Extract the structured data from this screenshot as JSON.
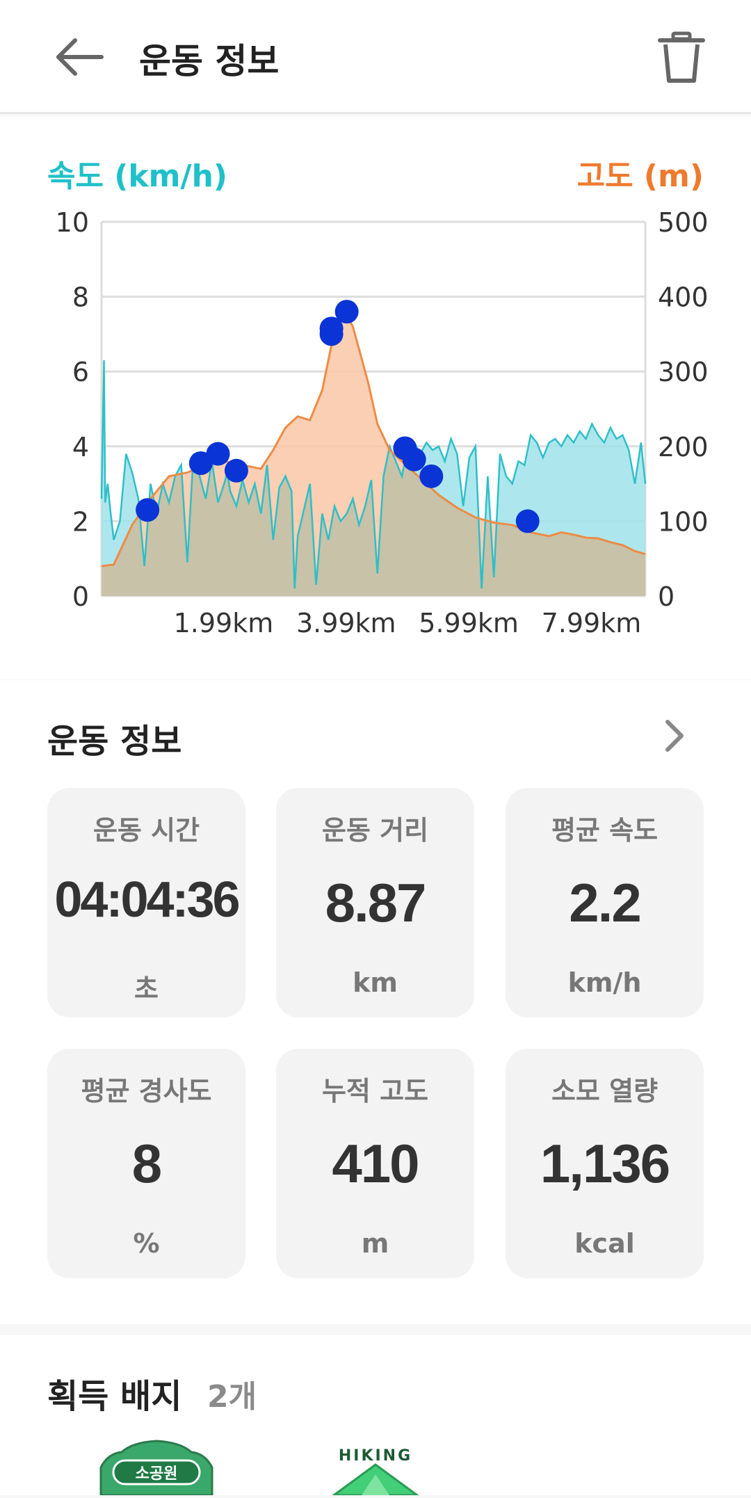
{
  "header": {
    "title": "운동 정보",
    "back_icon": "arrow-left-icon",
    "delete_icon": "trash-icon"
  },
  "chart_data": {
    "type": "area",
    "left_axis_label": "속도 (km/h)",
    "right_axis_label": "고도 (m)",
    "left_axis_color": "#1fc0c9",
    "right_axis_color": "#ee7a2e",
    "ylim_left": [
      0,
      10
    ],
    "ylim_right": [
      0,
      500
    ],
    "xlim": [
      0,
      8.87
    ],
    "y_ticks_left": [
      "0",
      "2",
      "4",
      "6",
      "8",
      "10"
    ],
    "y_ticks_right": [
      "0",
      "100",
      "200",
      "300",
      "400",
      "500"
    ],
    "x_tick_labels": [
      "1.99km",
      "3.99km",
      "5.99km",
      "7.99km"
    ],
    "x_tick_values": [
      1.99,
      3.99,
      5.99,
      7.99
    ],
    "grid": true,
    "series": [
      {
        "name": "속도",
        "axis": "left",
        "color": "#9fe3ea",
        "x": [
          0,
          0.04,
          0.06,
          0.1,
          0.15,
          0.2,
          0.3,
          0.4,
          0.5,
          0.6,
          0.7,
          0.8,
          0.9,
          1.0,
          1.1,
          1.2,
          1.3,
          1.4,
          1.5,
          1.6,
          1.7,
          1.8,
          1.9,
          2.0,
          2.05,
          2.1,
          2.2,
          2.3,
          2.4,
          2.5,
          2.6,
          2.7,
          2.8,
          2.9,
          3.0,
          3.1,
          3.15,
          3.2,
          3.3,
          3.4,
          3.5,
          3.6,
          3.7,
          3.8,
          3.9,
          4.0,
          4.1,
          4.2,
          4.3,
          4.4,
          4.5,
          4.6,
          4.7,
          4.8,
          4.9,
          5.0,
          5.05,
          5.1,
          5.2,
          5.3,
          5.4,
          5.5,
          5.6,
          5.7,
          5.8,
          5.9,
          6.0,
          6.1,
          6.2,
          6.3,
          6.4,
          6.5,
          6.6,
          6.7,
          6.8,
          6.9,
          7.0,
          7.1,
          7.2,
          7.3,
          7.4,
          7.5,
          7.6,
          7.7,
          7.8,
          7.9,
          8.0,
          8.1,
          8.2,
          8.3,
          8.4,
          8.5,
          8.6,
          8.7,
          8.8,
          8.87
        ],
        "values": [
          2.6,
          6.3,
          2.5,
          3.0,
          2.2,
          1.5,
          2.0,
          3.8,
          3.3,
          2.6,
          0.8,
          3.0,
          2.2,
          3.0,
          2.5,
          3.2,
          3.5,
          0.9,
          3.8,
          3.2,
          2.6,
          3.6,
          2.5,
          3.0,
          3.3,
          2.8,
          2.4,
          3.1,
          2.5,
          3.0,
          2.2,
          3.5,
          1.5,
          2.9,
          3.2,
          2.8,
          0.2,
          1.6,
          2.3,
          3.0,
          0.3,
          2.2,
          1.5,
          2.4,
          2.0,
          2.2,
          2.6,
          1.9,
          2.4,
          3.1,
          0.6,
          3.2,
          4.0,
          3.6,
          3.2,
          4.0,
          3.9,
          4.1,
          3.8,
          4.1,
          3.9,
          4.0,
          3.6,
          4.2,
          3.8,
          2.4,
          3.7,
          4.0,
          0.2,
          3.2,
          0.5,
          3.8,
          3.2,
          3.0,
          3.6,
          3.5,
          4.3,
          4.1,
          3.7,
          4.1,
          4.2,
          4.0,
          4.3,
          4.1,
          4.4,
          4.2,
          4.6,
          4.3,
          4.1,
          4.5,
          4.2,
          4.3,
          3.9,
          3.0,
          4.1,
          3.0
        ]
      },
      {
        "name": "고도",
        "axis": "right",
        "color": "#f9c7a6",
        "x": [
          0,
          0.2,
          0.5,
          0.8,
          1.1,
          1.4,
          1.7,
          2.0,
          2.3,
          2.6,
          2.8,
          3.0,
          3.2,
          3.4,
          3.6,
          3.75,
          3.9,
          4.0,
          4.1,
          4.2,
          4.35,
          4.5,
          4.7,
          4.9,
          5.1,
          5.3,
          5.5,
          5.8,
          6.1,
          6.4,
          6.7,
          7.0,
          7.3,
          7.5,
          7.7,
          7.9,
          8.1,
          8.3,
          8.5,
          8.7,
          8.87
        ],
        "values": [
          40,
          42,
          95,
          130,
          160,
          165,
          175,
          180,
          175,
          170,
          195,
          225,
          240,
          235,
          275,
          335,
          380,
          375,
          360,
          330,
          285,
          230,
          195,
          180,
          165,
          150,
          135,
          118,
          105,
          98,
          95,
          85,
          80,
          85,
          82,
          78,
          77,
          72,
          68,
          60,
          56
        ]
      }
    ],
    "markers": {
      "color": "#0a34d6",
      "points": [
        {
          "x": 0.75,
          "y": 2.3
        },
        {
          "x": 1.62,
          "y": 3.55
        },
        {
          "x": 1.9,
          "y": 3.8
        },
        {
          "x": 2.2,
          "y": 3.35
        },
        {
          "x": 3.75,
          "y": 7.0
        },
        {
          "x": 3.75,
          "y": 7.15
        },
        {
          "x": 4.0,
          "y": 7.6
        },
        {
          "x": 4.95,
          "y": 3.95
        },
        {
          "x": 5.1,
          "y": 3.65
        },
        {
          "x": 5.38,
          "y": 3.2
        },
        {
          "x": 6.95,
          "y": 2.0
        }
      ]
    }
  },
  "workout": {
    "title": "운동 정보",
    "chevron_icon": "chevron-right-icon",
    "stats": [
      {
        "label": "운동 시간",
        "value": "04:04:36",
        "unit": "초"
      },
      {
        "label": "운동 거리",
        "value": "8.87",
        "unit": "km"
      },
      {
        "label": "평균 속도",
        "value": "2.2",
        "unit": "km/h"
      },
      {
        "label": "평균 경사도",
        "value": "8",
        "unit": "%"
      },
      {
        "label": "누적 고도",
        "value": "410",
        "unit": "m"
      },
      {
        "label": "소모 열량",
        "value": "1,136",
        "unit": "kcal"
      }
    ]
  },
  "badges": {
    "title": "획득 배지",
    "count": "2개",
    "items": [
      {
        "text": "소공원",
        "icon": "park-badge-icon",
        "color": "#2e9d5f"
      },
      {
        "text": "HIKING",
        "icon": "hiking-badge-icon",
        "color": "#36c46c"
      }
    ]
  }
}
